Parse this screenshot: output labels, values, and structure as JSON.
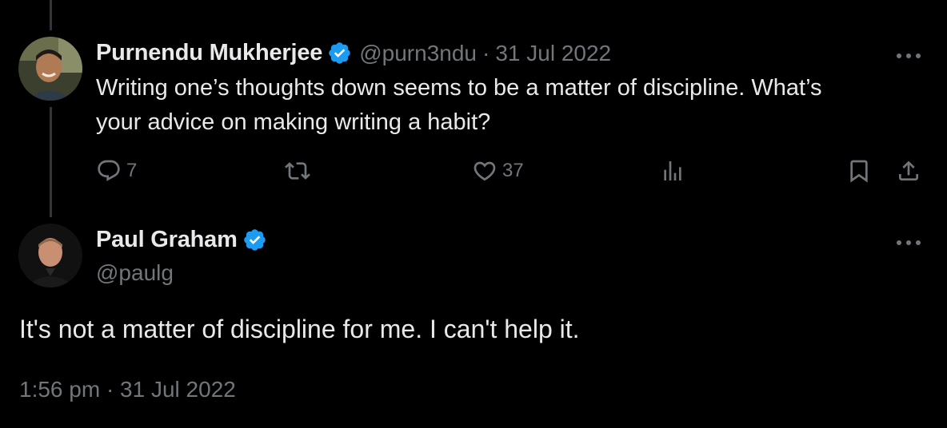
{
  "parent_tweet": {
    "author_name": "Purnendu Mukherjee",
    "handle": "@purn3ndu",
    "separator": "·",
    "date": "31 Jul 2022",
    "text_line1": "Writing one’s thoughts down seems to be a matter of discipline. What’s",
    "text_line2": "your advice on making writing a habit?",
    "reply_count": "7",
    "like_count": "37"
  },
  "main_tweet": {
    "author_name": "Paul Graham",
    "handle": "@paulg",
    "text": "It's not a matter of discipline for me. I can't help it.",
    "timestamp": "1:56 pm · 31 Jul 2022"
  },
  "colors": {
    "background": "#000000",
    "primary_text": "#e7e9ea",
    "secondary_text": "#71767b",
    "verified_blue": "#1d9bf0",
    "thread_line": "#333639"
  },
  "icons": [
    "verified-badge-icon",
    "more-options-icon",
    "reply-icon",
    "retweet-icon",
    "like-icon",
    "views-icon",
    "bookmark-icon",
    "share-icon"
  ]
}
